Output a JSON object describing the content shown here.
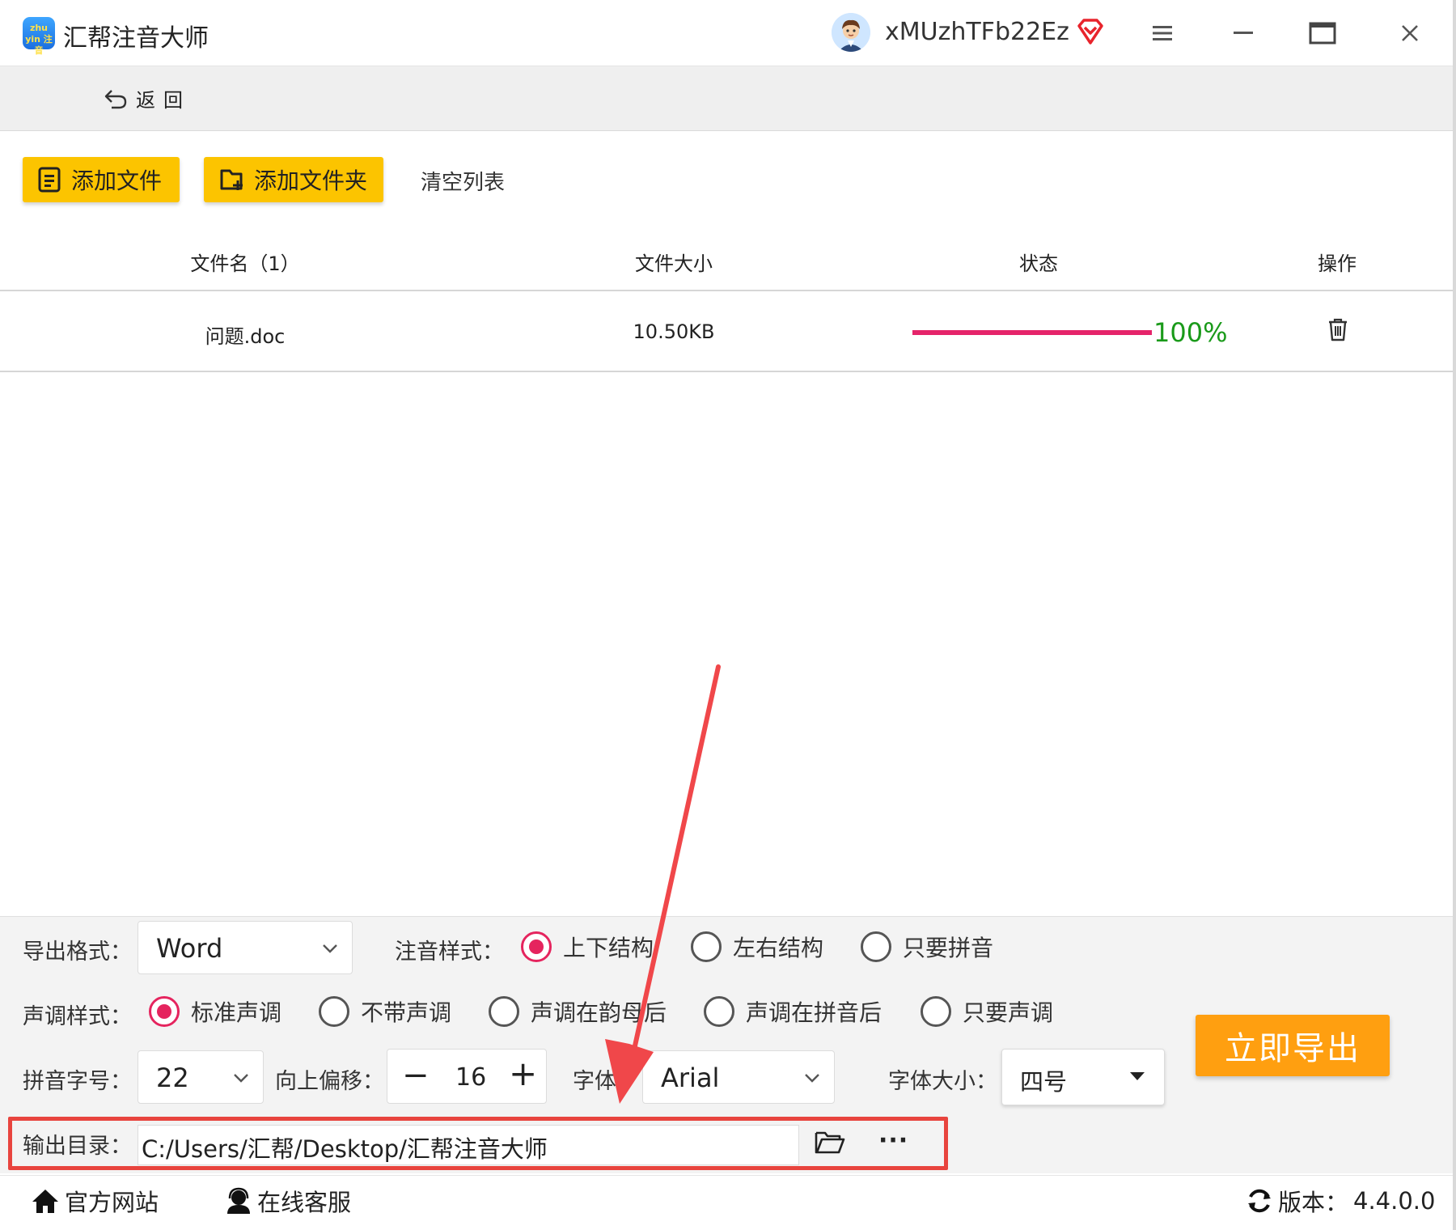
{
  "titlebar": {
    "app_title": "汇帮注音大师",
    "logo_text": "zhu yin 注音",
    "username": "xMUzhTFb22Ez"
  },
  "backbar": {
    "back_label": "返回"
  },
  "toolbar": {
    "add_file": "添加文件",
    "add_folder": "添加文件夹",
    "clear_list": "清空列表"
  },
  "table": {
    "headers": [
      "文件名（1）",
      "文件大小",
      "状态",
      "操作"
    ],
    "rows": [
      {
        "name": "问题.doc",
        "size": "10.50KB",
        "progress": 1.0,
        "progress_text": "100%"
      }
    ]
  },
  "settings": {
    "export_format_label": "导出格式：",
    "export_format_value": "Word",
    "annotation_style_label": "注音样式：",
    "annotation_options": [
      "上下结构",
      "左右结构",
      "只要拼音"
    ],
    "annotation_selected": 0,
    "tone_style_label": "声调样式：",
    "tone_options": [
      "标准声调",
      "不带声调",
      "声调在韵母后",
      "声调在拼音后",
      "只要声调"
    ],
    "tone_selected": 0,
    "pinyin_size_label": "拼音字号：",
    "pinyin_size_value": "22",
    "offset_label": "向上偏移：",
    "offset_value": "16",
    "font_label": "字体：",
    "font_value": "Arial",
    "font_size_label": "字体大小：",
    "font_size_value": "四号",
    "output_dir_label": "输出目录：",
    "output_dir_value": "C:/Users/汇帮/Desktop/汇帮注音大师",
    "more_label": "···",
    "export_button": "立即导出"
  },
  "footer": {
    "website": "官方网站",
    "support": "在线客服",
    "version_label": "版本：",
    "version_value": "4.4.0.0"
  },
  "colors": {
    "accent_yellow": "#fcc400",
    "export_orange": "#ff9f10",
    "progress_pink": "#e5246a",
    "progress_green": "#1a9a1a",
    "radio_red": "#e5245e",
    "highlight_red": "#e8443e"
  }
}
